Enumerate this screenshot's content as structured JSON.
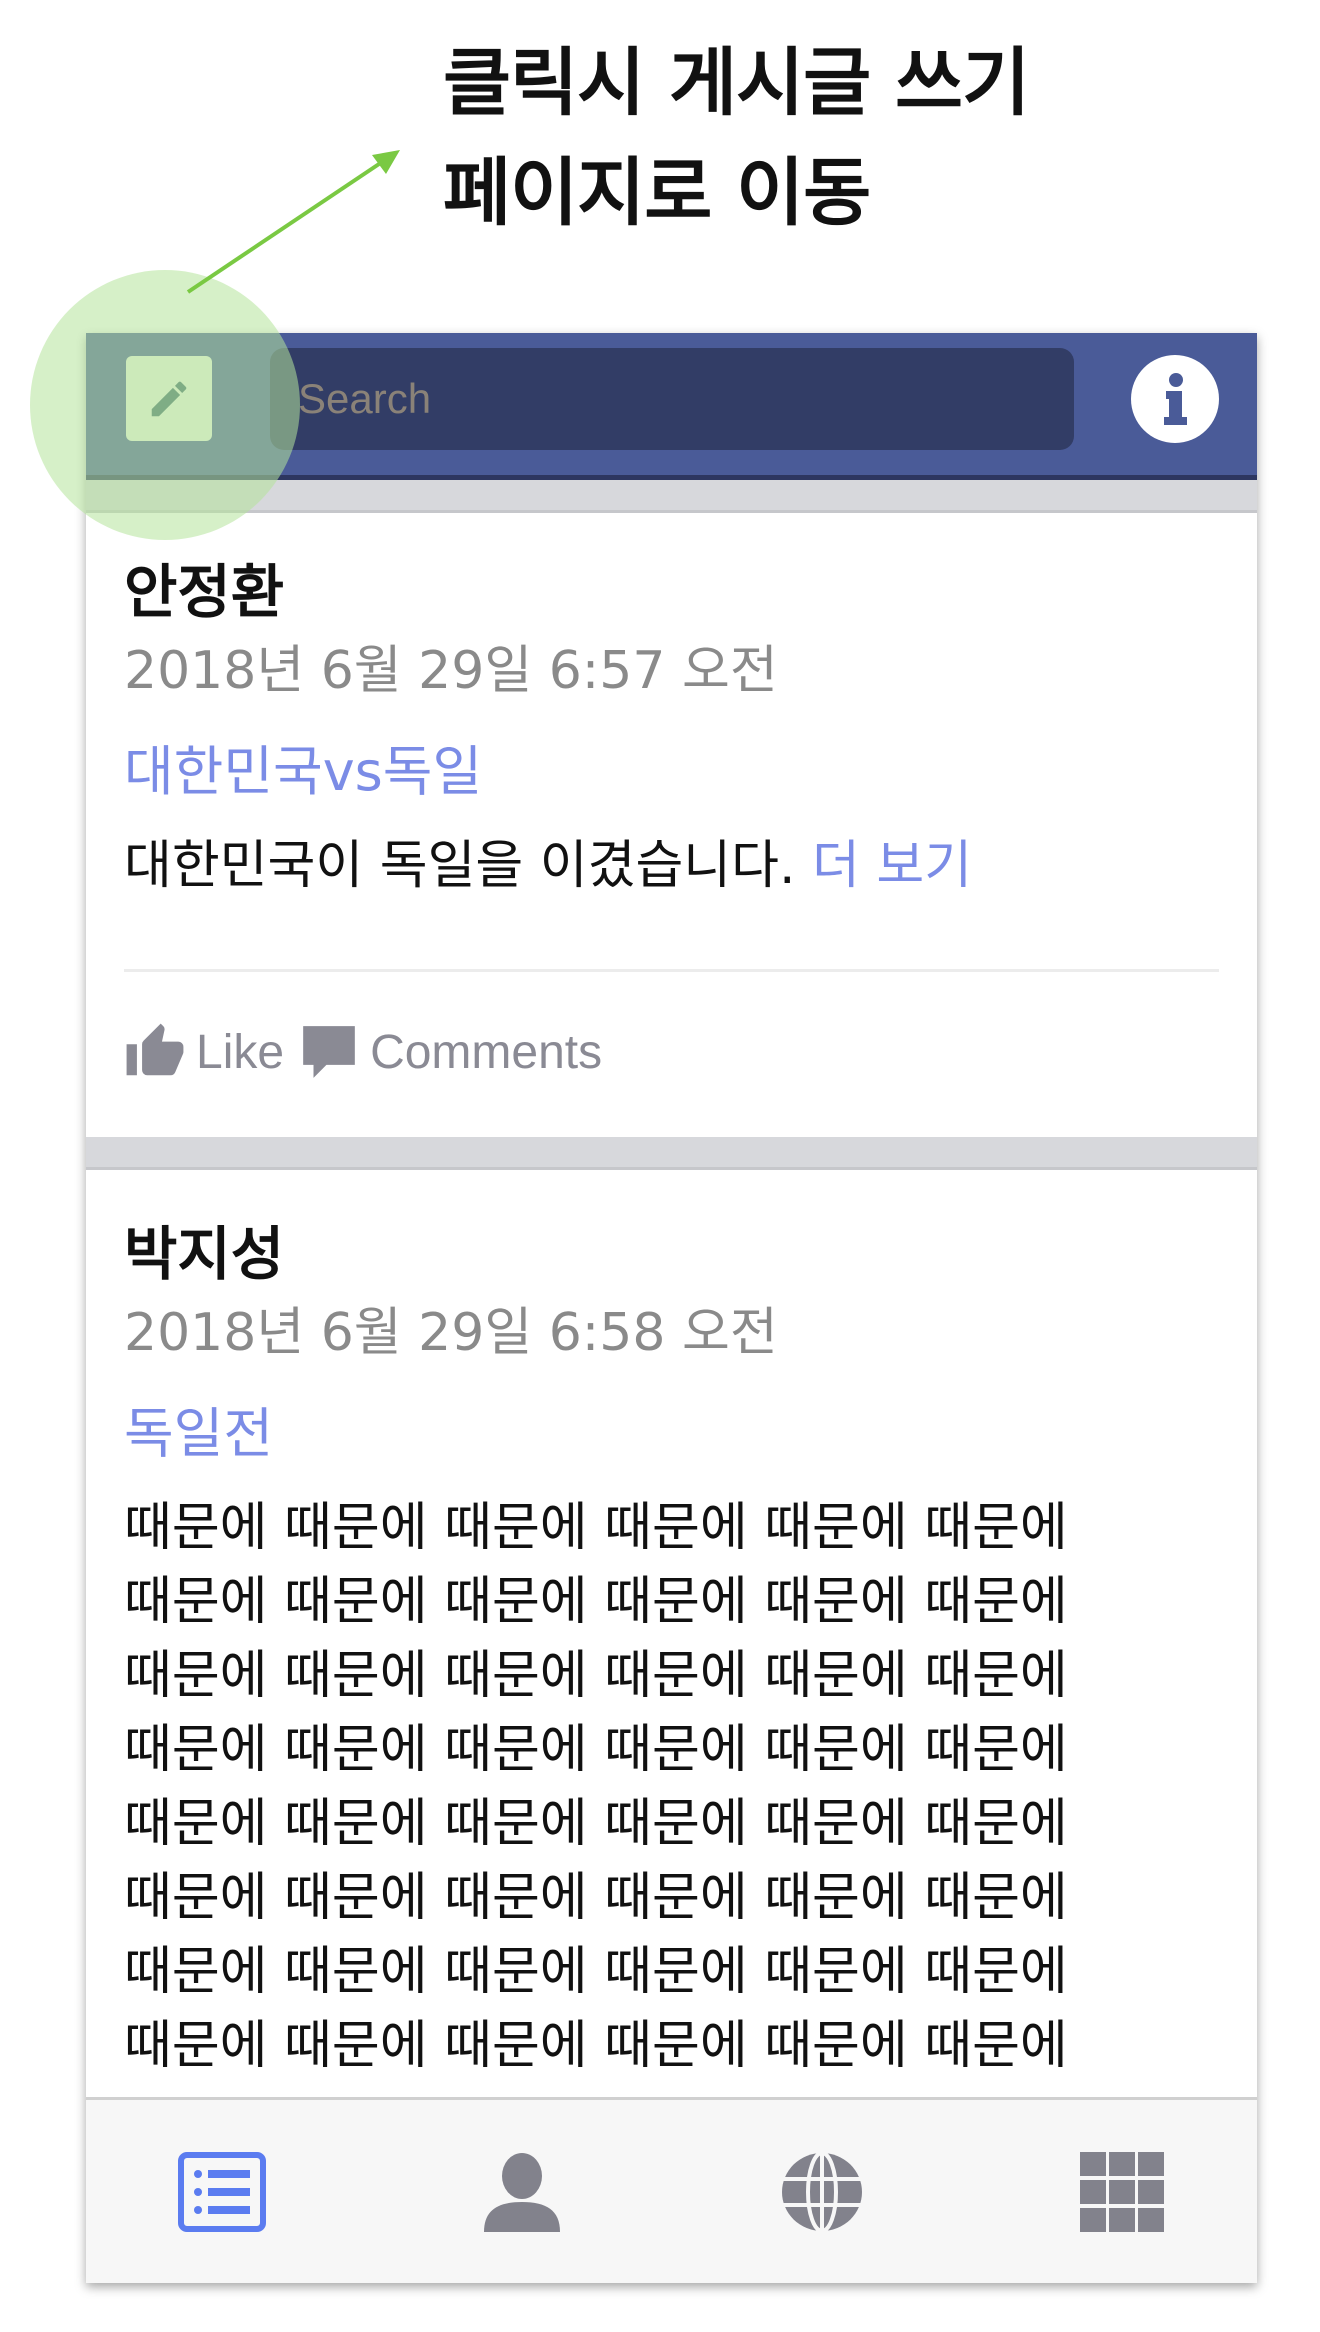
{
  "annotation": {
    "lines": [
      "클릭시 게시글 쓰기",
      "페이지로 이동"
    ],
    "highlight_color": "#b5e39a",
    "arrow_color": "#7ac943"
  },
  "header": {
    "compose_icon": "pencil-icon",
    "search_placeholder": "Search",
    "info_icon": "info-icon",
    "bar_color": "#4a5b98"
  },
  "posts": [
    {
      "author": "안정환",
      "timestamp": "2018년 6월 29일 6:57 오전",
      "title": "대한민국vs독일",
      "body": "대한민국이 독일을 이겼습니다.",
      "more_label": "더 보기",
      "like_label": "Like",
      "comments_label": "Comments"
    },
    {
      "author": "박지성",
      "timestamp": "2018년 6월 29일 6:58 오전",
      "title": "독일전",
      "body_lines": [
        "때문에 때문에 때문에 때문에 때문에 때문에",
        "때문에 때문에 때문에 때문에 때문에 때문에",
        "때문에 때문에 때문에 때문에 때문에 때문에",
        "때문에 때문에 때문에 때문에 때문에 때문에",
        "때문에 때문에 때문에 때문에 때문에 때문에",
        "때문에 때문에 때문에 때문에 때문에 때문에",
        "때문에 때문에 때문에 때문에 때문에 때문에",
        "때문에 때문에 때문에 때문에 때문에 때문에"
      ]
    }
  ],
  "tabbar": {
    "tabs": [
      {
        "icon": "list-icon",
        "active": true
      },
      {
        "icon": "person-icon",
        "active": false
      },
      {
        "icon": "globe-icon",
        "active": false
      },
      {
        "icon": "grid-icon",
        "active": false
      }
    ],
    "active_color": "#5b7cf0",
    "inactive_color": "#82828c"
  }
}
